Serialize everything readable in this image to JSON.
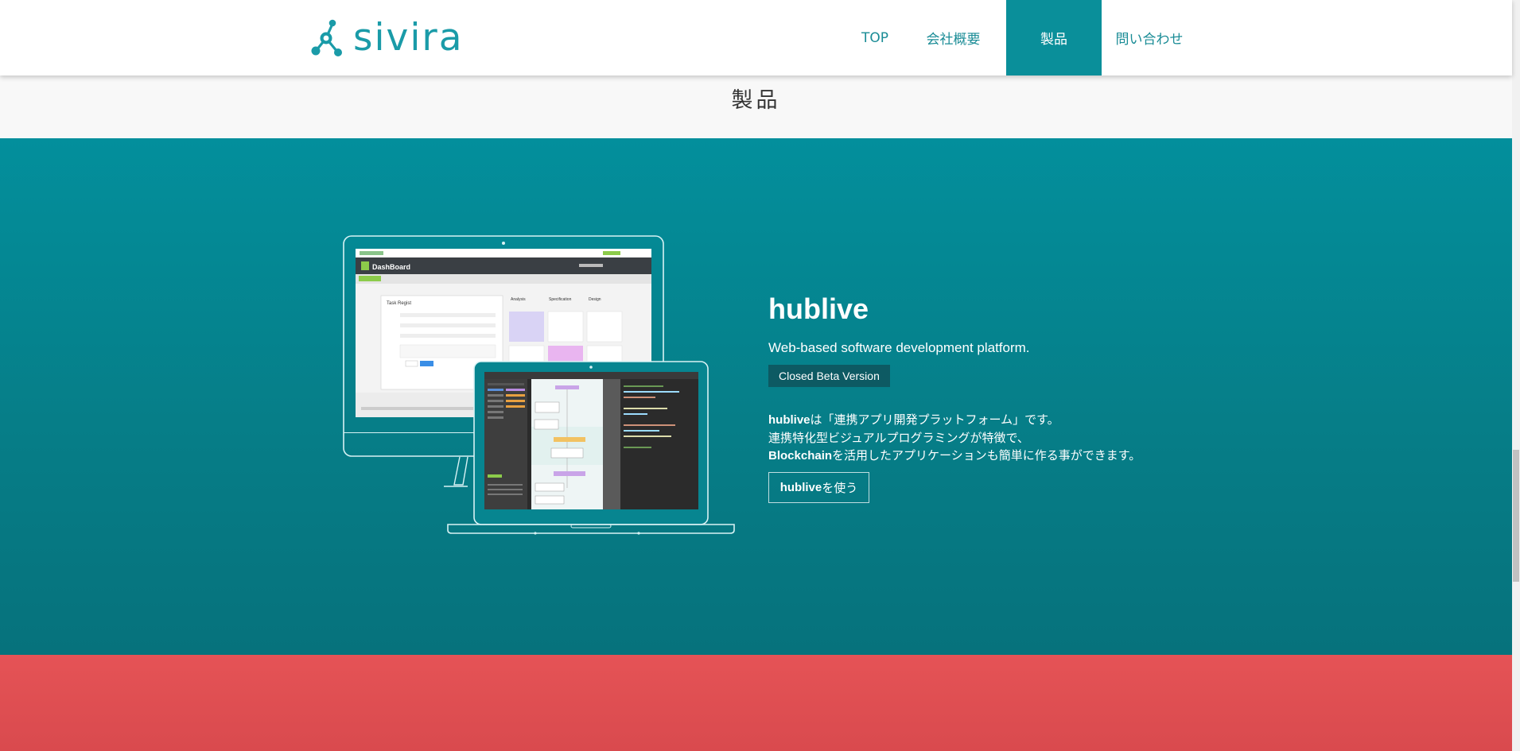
{
  "header": {
    "logo_text": "sivira",
    "nav": [
      {
        "label": "TOP"
      },
      {
        "label": "会社概要"
      },
      {
        "label": "製品"
      },
      {
        "label": "問い合わせ"
      }
    ],
    "active_nav": "製品"
  },
  "page": {
    "title": "製品"
  },
  "product": {
    "name": "hublive",
    "tagline": "Web-based software development platform.",
    "badge": "Closed Beta Version",
    "desc_line1_bold": "hublive",
    "desc_line1_rest": "は「連携アプリ開発プラットフォーム」です。",
    "desc_line2": "連携特化型ビジュアルプログラミングが特徴で、",
    "desc_line3_bold": "Blockchain",
    "desc_line3_rest": "を活用したアプリケーションも簡単に作る事ができます。",
    "button_bold": "hublive",
    "button_rest": "を使う"
  },
  "illustration": {
    "dashboard_title": "DashBoard",
    "task_panel_title": "Task Regist",
    "columns": [
      "Analysis",
      "Specification",
      "Design"
    ]
  },
  "colors": {
    "brand": "#1a9ba8",
    "nav_active_bg": "#0a8f9a",
    "hero_top": "#038f9c",
    "hero_bottom": "#06727c",
    "badge_bg": "#0d5a63",
    "red_band": "#e55356"
  }
}
